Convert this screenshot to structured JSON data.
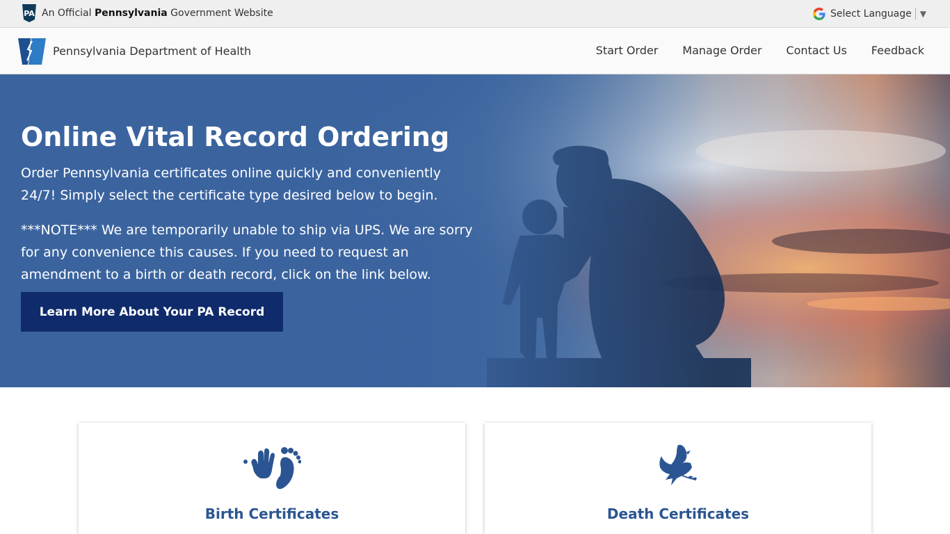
{
  "gov_bar": {
    "badge_text": "PA",
    "prefix": "An Official ",
    "state": "Pennsylvania",
    "suffix": " Government Website",
    "language_label": "Select Language",
    "language_caret": "▼"
  },
  "header": {
    "department": "Pennsylvania Department of Health",
    "nav": [
      {
        "label": "Start Order"
      },
      {
        "label": "Manage Order"
      },
      {
        "label": "Contact Us"
      },
      {
        "label": "Feedback"
      }
    ]
  },
  "hero": {
    "title": "Online Vital Record Ordering",
    "paragraph1": "Order Pennsylvania certificates online quickly and conveniently 24/7! Simply select the certificate type desired below to begin.",
    "paragraph2": "***NOTE*** We are temporarily unable to ship via UPS. We are sorry for any convenience this causes. If you need to request an amendment to a birth or death record, click on the link below.",
    "button_label": "Learn More About Your PA Record"
  },
  "cards": [
    {
      "title": "Birth Certificates",
      "icon": "hand-foot-print-icon"
    },
    {
      "title": "Death Certificates",
      "icon": "dove-icon"
    }
  ],
  "colors": {
    "brand_navy": "#0f2b6b",
    "card_title": "#2b5592",
    "hero_blue": "#3b649f"
  }
}
